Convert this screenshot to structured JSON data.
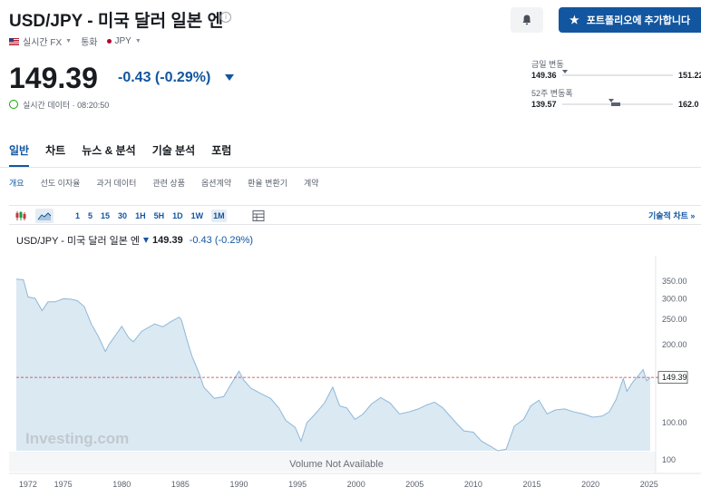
{
  "header": {
    "title": "USD/JPY - 미국 달러 일본 엔",
    "info_icon": "info-icon",
    "meta_realtime": "실시간 FX",
    "meta_type": "통화",
    "meta_currency": "JPY",
    "alert_icon": "bell-plus-icon",
    "portfolio_button": "포트폴리오에 추가합니다"
  },
  "quote": {
    "price": "149.39",
    "change": "-0.43 (-0.29%)",
    "realtime_label": "실시간 데이터 · 08:20:50",
    "down_color": "#1256a0"
  },
  "ranges": {
    "day_label": "금일 변동",
    "day_low": "149.36",
    "day_high": "151.22",
    "week52_label": "52주 변동폭",
    "week52_low": "139.57",
    "week52_high": "162.0"
  },
  "tabs": [
    "일반",
    "차트",
    "뉴스 & 분석",
    "기술 분석",
    "포럼"
  ],
  "subtabs": [
    "개요",
    "선도 이자율",
    "과거 데이터",
    "관련 상품",
    "옵션계약",
    "환율 변환기",
    "계약"
  ],
  "toolbar": {
    "intervals": [
      "1",
      "5",
      "15",
      "30",
      "1H",
      "5H",
      "1D",
      "1W",
      "1M"
    ],
    "selected_interval": "1M",
    "tech_chart_link": "기술적 차트 »"
  },
  "legend": {
    "name": "USD/JPY - 미국 달러 일본 엔",
    "price": "149.39",
    "change": "-0.43 (-0.29%)"
  },
  "watermark": "Investing.com",
  "volume_note": "Volume Not Available",
  "chart_data": {
    "type": "area",
    "title": "",
    "xlabel": "",
    "ylabel": "",
    "y_scale": "log",
    "ylim": [
      78,
      380
    ],
    "y_ticks": [
      100,
      150,
      200,
      250,
      300,
      350
    ],
    "x_ticks": [
      1972,
      1975,
      1980,
      1985,
      1990,
      1995,
      2000,
      2005,
      2010,
      2015,
      2020,
      2025
    ],
    "current_value_label": "149.39",
    "line_color": "#8fb8d8",
    "fill_color": "#dbe9f3",
    "ref_line_color": "#c23b3b",
    "series": [
      {
        "x": [
          1971.0,
          1971.6,
          1972.0,
          1972.6,
          1973.2,
          1973.7,
          1974.3,
          1975.0,
          1975.6,
          1976.2,
          1976.8,
          1977.4,
          1978.0,
          1978.6,
          1978.9,
          1979.4,
          1980.0,
          1980.6,
          1981.0,
          1981.7,
          1982.8,
          1983.5,
          1984.2,
          1984.9,
          1985.1,
          1985.6,
          1986.0,
          1986.6,
          1987.0,
          1987.9,
          1988.7,
          1989.3,
          1990.0,
          1990.4,
          1991.0,
          1991.8,
          1992.7,
          1993.4,
          1994.0,
          1994.8,
          1995.3,
          1995.8,
          1996.5,
          1997.3,
          1998.0,
          1998.6,
          1999.2,
          1999.9,
          2000.6,
          2001.3,
          2002.1,
          2002.9,
          2003.7,
          2004.5,
          2005.3,
          2006.0,
          2006.7,
          2007.4,
          2008.1,
          2008.7,
          2009.2,
          2010.0,
          2010.7,
          2011.5,
          2012.1,
          2012.8,
          2013.5,
          2014.3,
          2014.9,
          2015.6,
          2016.3,
          2017.0,
          2017.8,
          2018.6,
          2019.4,
          2020.2,
          2021.0,
          2021.6,
          2022.2,
          2022.8,
          2023.1,
          2023.6,
          2024.0,
          2024.5,
          2024.8,
          2025.1
        ],
        "values": [
          357,
          355,
          305,
          301,
          270,
          292,
          292,
          300,
          299,
          295,
          280,
          240,
          215,
          188,
          200,
          215,
          235,
          212,
          205,
          225,
          240,
          234,
          245,
          255,
          248,
          206,
          180,
          155,
          137,
          124,
          126,
          140,
          158,
          146,
          136,
          130,
          124,
          114,
          102,
          96,
          85,
          100,
          108,
          119,
          137,
          116,
          114,
          103,
          108,
          118,
          125,
          119,
          108,
          110,
          113,
          117,
          120,
          114,
          105,
          98,
          93,
          92,
          85,
          81,
          78,
          79,
          97,
          103,
          116,
          122,
          108,
          112,
          113,
          110,
          108,
          105,
          106,
          110,
          123,
          148,
          132,
          143,
          150,
          160,
          145,
          149.39
        ]
      }
    ]
  }
}
